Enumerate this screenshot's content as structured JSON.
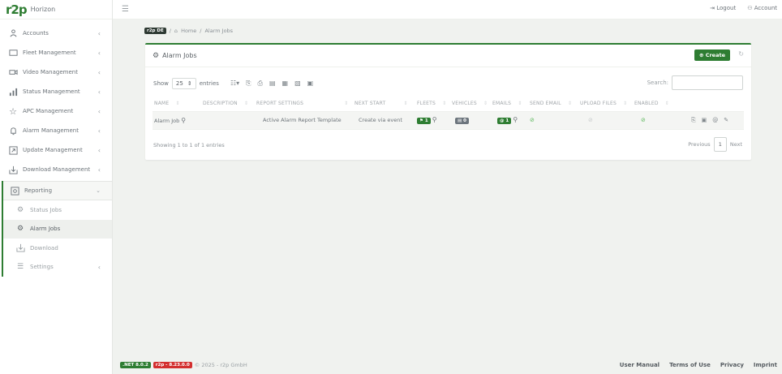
{
  "app": {
    "logo": "r2p",
    "name": "Horizon"
  },
  "topbar": {
    "menu_icon": "hamburger-icon",
    "logout": "Logout",
    "account": "Account"
  },
  "sidebar": {
    "items": [
      {
        "label": "Accounts",
        "icon": "accounts-icon"
      },
      {
        "label": "Fleet Management",
        "icon": "fleet-icon"
      },
      {
        "label": "Video Management",
        "icon": "video-icon"
      },
      {
        "label": "Status Management",
        "icon": "status-icon"
      },
      {
        "label": "APC Management",
        "icon": "star-icon"
      },
      {
        "label": "Alarm Management",
        "icon": "bell-icon"
      },
      {
        "label": "Update Management",
        "icon": "update-icon"
      },
      {
        "label": "Download Management",
        "icon": "download-icon"
      }
    ],
    "reporting": {
      "label": "Reporting",
      "sub": [
        {
          "label": "Status Jobs"
        },
        {
          "label": "Alarm Jobs"
        },
        {
          "label": "Download"
        },
        {
          "label": "Settings"
        }
      ]
    }
  },
  "breadcrumb": {
    "tenant": "r2p DE",
    "home": "Home",
    "sep": "/",
    "current": "Alarm Jobs"
  },
  "card": {
    "title": "Alarm Jobs",
    "create": "Create",
    "show": "Show",
    "page_size": "25",
    "entries": "entries",
    "search": "Search:",
    "columns": [
      "NAME",
      "DESCRIPTION",
      "REPORT SETTINGS",
      "NEXT START",
      "FLEETS",
      "VEHICLES",
      "EMAILS",
      "SEND EMAIL",
      "UPLOAD FILES",
      "ENABLED"
    ],
    "row": {
      "name": "Alarm Job",
      "report_settings": "Active Alarm Report Template",
      "next_start": "Create via event",
      "fleets": "1",
      "vehicles": "0",
      "emails": "1"
    },
    "info": "Showing 1 to 1 of 1 entries",
    "previous": "Previous",
    "page": "1",
    "next": "Next"
  },
  "footer": {
    "net": ".NET 8.0.2",
    "ver": "r2p - 8.23.0.0",
    "copy": "© 2025 - r2p GmbH",
    "links": [
      "User Manual",
      "Terms of Use",
      "Privacy",
      "Imprint"
    ]
  },
  "colors": {
    "accent": "#2e7d32",
    "version_badge": "#d32f2f"
  }
}
